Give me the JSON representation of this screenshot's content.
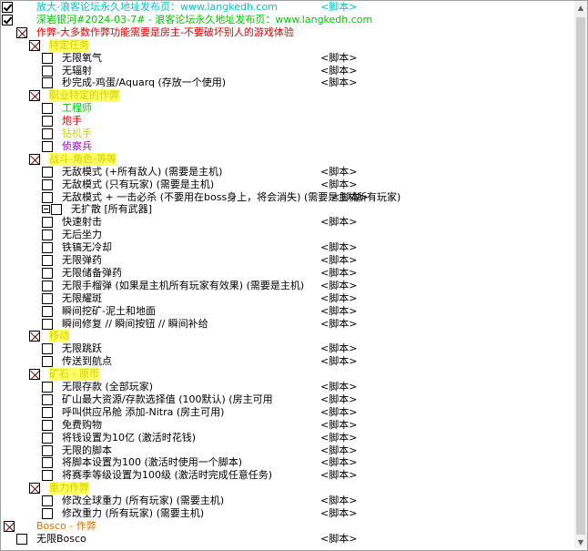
{
  "colors": {
    "cyan": "#00c8c8",
    "green": "#00c800",
    "red": "#e00000",
    "yellow": "#d0d000",
    "orange": "#e07000",
    "purple": "#a000c0",
    "black": "#000000"
  },
  "rows": [
    {
      "label": "放大-浪客论坛永久地址发布页：www.langkedh.com",
      "value": "<脚本>",
      "x": 40,
      "cb": "chk",
      "cbx": 2,
      "color": "cyan"
    },
    {
      "label": "深岩银河#2024-03-7# - 浪客论坛永久地址发布页：www.langkedh.com",
      "value": "",
      "x": 40,
      "cb": "chk",
      "cbx": 2,
      "color": "green"
    },
    {
      "label": "作弊-大多数作弊功能需要是房主-不要破坏别人的游戏体验",
      "value": "",
      "x": 40,
      "cb": "grp",
      "cbx": 18,
      "color": "red"
    },
    {
      "label": "特定任务",
      "value": "",
      "x": 54,
      "cb": "grp",
      "cbx": 32,
      "color": "yellow",
      "sel": true
    },
    {
      "label": "无限氧气",
      "value": "<脚本>",
      "x": 68,
      "cb": "box",
      "cbx": 46,
      "color": "black"
    },
    {
      "label": "无辐射",
      "value": "<脚本>",
      "x": 68,
      "cb": "box",
      "cbx": 46,
      "color": "black"
    },
    {
      "label": "秒完成-鸡蛋/Aquarq (存放一个使用)",
      "value": "<脚本>",
      "x": 68,
      "cb": "box",
      "cbx": 46,
      "color": "black"
    },
    {
      "label": "职业特定的作弊",
      "value": "",
      "x": 54,
      "cb": "grp",
      "cbx": 32,
      "color": "yellow",
      "sel": true
    },
    {
      "label": "工程师",
      "value": "",
      "x": 68,
      "cb": "box",
      "cbx": 46,
      "color": "green"
    },
    {
      "label": "炮手",
      "value": "",
      "x": 68,
      "cb": "box",
      "cbx": 46,
      "color": "red"
    },
    {
      "label": "钻机手",
      "value": "",
      "x": 68,
      "cb": "box",
      "cbx": 46,
      "color": "yellow"
    },
    {
      "label": "侦察兵",
      "value": "",
      "x": 68,
      "cb": "box",
      "cbx": 46,
      "color": "purple"
    },
    {
      "label": "战斗-角色-等等",
      "value": "",
      "x": 54,
      "cb": "grp",
      "cbx": 32,
      "color": "yellow",
      "sel": true
    },
    {
      "label": "无敌模式 (+所有敌人) (需要是主机)",
      "value": "<脚本>",
      "x": 68,
      "cb": "box",
      "cbx": 46,
      "color": "black"
    },
    {
      "label": "无敌模式 (只有玩家) (需要是主机)",
      "value": "<脚本>",
      "x": 68,
      "cb": "box",
      "cbx": 46,
      "color": "black"
    },
    {
      "label": "无敌模式 + 一击必杀 (不要用在boss身上，将会消失) (需要是主机)",
      "value": "<脚本>",
      "x": 68,
      "cb": "box",
      "cbx": 46,
      "color": "black",
      "value_x": 364,
      "value_after": "所有玩家)"
    },
    {
      "label": "无扩散 [所有武器]",
      "value": "",
      "x": 78,
      "cb": "box",
      "cbx": 56,
      "color": "black",
      "expander": true
    },
    {
      "label": "快速射击",
      "value": "<脚本>",
      "x": 68,
      "cb": "box",
      "cbx": 46,
      "color": "black"
    },
    {
      "label": "无后坐力",
      "value": "",
      "x": 68,
      "cb": "box",
      "cbx": 46,
      "color": "black"
    },
    {
      "label": "铁镐无冷却",
      "value": "<脚本>",
      "x": 68,
      "cb": "box",
      "cbx": 46,
      "color": "black"
    },
    {
      "label": "无限弹药",
      "value": "<脚本>",
      "x": 68,
      "cb": "box",
      "cbx": 46,
      "color": "black"
    },
    {
      "label": "无限储备弹药",
      "value": "<脚本>",
      "x": 68,
      "cb": "box",
      "cbx": 46,
      "color": "black"
    },
    {
      "label": "无限手榴弹 (如果是主机所有玩家有效果) (需要是主机)",
      "value": "<脚本>",
      "x": 68,
      "cb": "box",
      "cbx": 46,
      "color": "black"
    },
    {
      "label": "无限耀斑",
      "value": "<脚本>",
      "x": 68,
      "cb": "box",
      "cbx": 46,
      "color": "black"
    },
    {
      "label": "瞬间挖矿-泥土和地面",
      "value": "<脚本>",
      "x": 68,
      "cb": "box",
      "cbx": 46,
      "color": "black"
    },
    {
      "label": "瞬间修复 // 瞬间按钮 // 瞬间补给",
      "value": "<脚本>",
      "x": 68,
      "cb": "box",
      "cbx": 46,
      "color": "black"
    },
    {
      "label": "移动",
      "value": "",
      "x": 54,
      "cb": "grp",
      "cbx": 32,
      "color": "yellow",
      "sel": true
    },
    {
      "label": "无限跳跃",
      "value": "<脚本>",
      "x": 68,
      "cb": "box",
      "cbx": 46,
      "color": "black"
    },
    {
      "label": "传送到航点",
      "value": "<脚本>",
      "x": 68,
      "cb": "box",
      "cbx": 46,
      "color": "black"
    },
    {
      "label": "矿石 - 原币",
      "value": "",
      "x": 54,
      "cb": "grp",
      "cbx": 32,
      "color": "yellow",
      "sel": true
    },
    {
      "label": "无限存款 (全部玩家)",
      "value": "<脚本>",
      "x": 68,
      "cb": "box",
      "cbx": 46,
      "color": "black"
    },
    {
      "label": "矿山最大资源/存款选择值 (100默认) (房主可用",
      "value": "<脚本>",
      "x": 68,
      "cb": "box",
      "cbx": 46,
      "color": "black"
    },
    {
      "label": "呼叫供应吊舱 添加-Nitra (房主可用)",
      "value": "<脚本>",
      "x": 68,
      "cb": "box",
      "cbx": 46,
      "color": "black"
    },
    {
      "label": "免费购物",
      "value": "<脚本>",
      "x": 68,
      "cb": "box",
      "cbx": 46,
      "color": "black"
    },
    {
      "label": "将钱设置为10亿 (激活时花钱)",
      "value": "<脚本>",
      "x": 68,
      "cb": "box",
      "cbx": 46,
      "color": "black"
    },
    {
      "label": "无限的脚本",
      "value": "<脚本>",
      "x": 68,
      "cb": "box",
      "cbx": 46,
      "color": "black"
    },
    {
      "label": "将脚本设置为100 (激活时使用一个脚本)",
      "value": "<脚本>",
      "x": 68,
      "cb": "box",
      "cbx": 46,
      "color": "black"
    },
    {
      "label": "将赛季等级设置为100级  (激活时完成任意任务)",
      "value": "<脚本>",
      "x": 68,
      "cb": "box",
      "cbx": 46,
      "color": "black"
    },
    {
      "label": "重力作弊",
      "value": "",
      "x": 54,
      "cb": "grp",
      "cbx": 32,
      "color": "yellow",
      "sel": true
    },
    {
      "label": "修改全球重力 (所有玩家) (需要主机)",
      "value": "<脚本>",
      "x": 68,
      "cb": "box",
      "cbx": 46,
      "color": "black"
    },
    {
      "label": "修改重力  (所有玩家) (需要主机)",
      "value": "<脚本>",
      "x": 68,
      "cb": "box",
      "cbx": 46,
      "color": "black"
    },
    {
      "label": "Bosco - 作弊",
      "value": "",
      "x": 40,
      "cb": "grp",
      "cbx": 4,
      "color": "orange"
    },
    {
      "label": "无限Bosco",
      "value": "<脚本>",
      "x": 40,
      "cb": "box",
      "cbx": 18,
      "color": "black"
    }
  ]
}
